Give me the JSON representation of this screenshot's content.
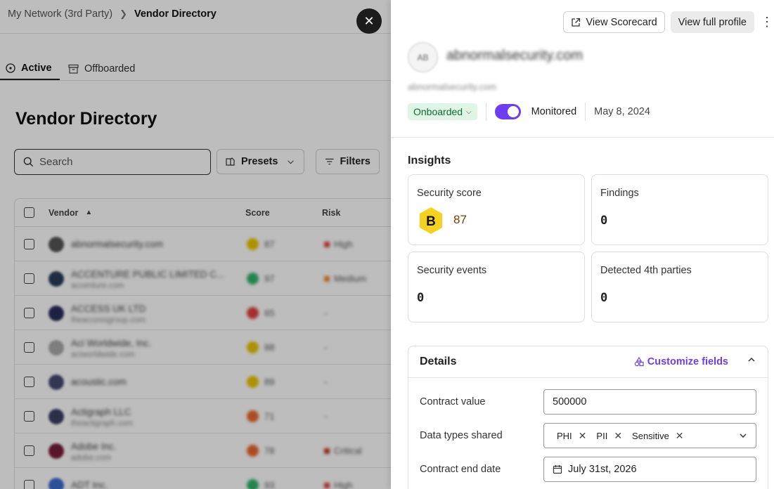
{
  "breadcrumb": {
    "parent": "My Network (3rd Party)",
    "current": "Vendor Directory"
  },
  "tabs": [
    {
      "label": "Active"
    },
    {
      "label": "Offboarded"
    }
  ],
  "page": {
    "title": "Vendor Directory"
  },
  "search": {
    "placeholder": "Search"
  },
  "toolbar": {
    "presets_label": "Presets",
    "filters_label": "Filters"
  },
  "table": {
    "headers": {
      "vendor": "Vendor",
      "score": "Score",
      "risk": "Risk"
    },
    "rows": [
      {
        "name": "abnormalsecurity.com",
        "domain": "",
        "avatar_color": "#555",
        "score": "87",
        "score_color": "#e8c400",
        "risk": "High",
        "risk_color": "#e04040"
      },
      {
        "name": "ACCENTURE PUBLIC LIMITED C...",
        "domain": "accenture.com",
        "avatar_color": "#2b3d55",
        "score": "97",
        "score_color": "#2fb36b",
        "risk": "Medium",
        "risk_color": "#e7882b"
      },
      {
        "name": "ACCESS UK LTD",
        "domain": "theaccessgroup.com",
        "avatar_color": "#2c2c5a",
        "score": "65",
        "score_color": "#e03e3e",
        "risk": "-",
        "risk_color": "#999"
      },
      {
        "name": "Aci Worldwide, Inc.",
        "domain": "aciworldwide.com",
        "avatar_color": "#aaa",
        "score": "88",
        "score_color": "#e8c400",
        "risk": "-",
        "risk_color": "#999"
      },
      {
        "name": "acoustic.com",
        "domain": "",
        "avatar_color": "#4a4a70",
        "score": "89",
        "score_color": "#e8c400",
        "risk": "-",
        "risk_color": "#999"
      },
      {
        "name": "Actigraph LLC",
        "domain": "theactigraph.com",
        "avatar_color": "#3e3e5e",
        "score": "71",
        "score_color": "#e8662b",
        "risk": "-",
        "risk_color": "#999"
      },
      {
        "name": "Adobe Inc.",
        "domain": "adobe.com",
        "avatar_color": "#7a1f3a",
        "score": "78",
        "score_color": "#e8662b",
        "risk": "Critical",
        "risk_color": "#c0392b"
      },
      {
        "name": "ADT Inc.",
        "domain": "",
        "avatar_color": "#3d6fd0",
        "score": "93",
        "score_color": "#2fb36b",
        "risk": "High",
        "risk_color": "#e04040"
      }
    ]
  },
  "drawer": {
    "actions": {
      "scorecard": "View Scorecard",
      "profile": "View full profile"
    },
    "vendor_initials": "AB",
    "vendor_name": "abnormalsecurity.com",
    "vendor_domain": "abnormalsecurity.com",
    "status": "Onboarded",
    "monitored_label": "Monitored",
    "monitored": true,
    "date": "May 8, 2024",
    "insights": {
      "heading": "Insights",
      "security_score": {
        "label": "Security score",
        "grade": "B",
        "value": "87"
      },
      "findings": {
        "label": "Findings",
        "value": "0"
      },
      "security_events": {
        "label": "Security events",
        "value": "0"
      },
      "fourth_parties": {
        "label": "Detected 4th parties",
        "value": "0"
      }
    },
    "details": {
      "heading": "Details",
      "customize_label": "Customize fields",
      "contract_value": {
        "label": "Contract value",
        "value": "500000"
      },
      "data_types": {
        "label": "Data types shared",
        "chips": [
          "PHI",
          "PII",
          "Sensitive"
        ]
      },
      "contract_end": {
        "label": "Contract end date",
        "value": "July 31st, 2026"
      }
    }
  },
  "colors": {
    "accent": "#6d3df2",
    "onboarded_bg": "#dff5e6",
    "onboarded_text": "#0f6b33",
    "grade_b": "#f4d21f"
  }
}
